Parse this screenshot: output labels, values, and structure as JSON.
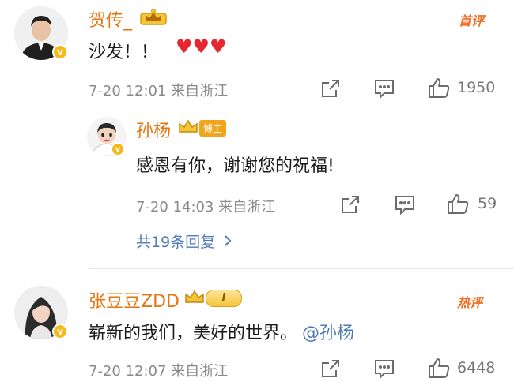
{
  "comment1": {
    "username": "贺传_",
    "tag": "首评",
    "text": "沙发！！",
    "meta": "7-20 12:01 来自浙江",
    "like_count": "1950"
  },
  "reply1": {
    "username": "孙杨",
    "badge_label": "博主",
    "text": "感恩有你，谢谢您的祝福!",
    "meta": "7-20 14:03 来自浙江",
    "like_count": "59",
    "more_replies": "共19条回复"
  },
  "comment2": {
    "username": "张豆豆ZDD",
    "level": "I",
    "tag": "热评",
    "text": "崭新的我们，美好的世界。",
    "mention": "@孙杨",
    "meta": "7-20 12:07 来自浙江",
    "like_count": "6448"
  },
  "colors": {
    "username": "#e8740d",
    "link": "#4d79b9",
    "tag": "#f06b1e",
    "heart": "#e8262e"
  },
  "icons": [
    "share-icon",
    "comment-icon",
    "thumbs-up-icon",
    "heart-icon",
    "crown-icon",
    "verified-badge-icon",
    "chevron-right-icon"
  ]
}
